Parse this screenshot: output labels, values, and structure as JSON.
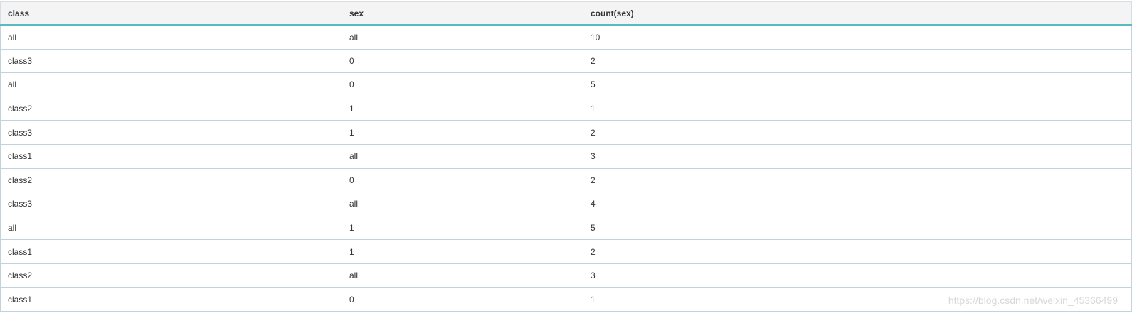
{
  "table": {
    "headers": [
      "class",
      "sex",
      "count(sex)"
    ],
    "rows": [
      [
        "all",
        "all",
        "10"
      ],
      [
        "class3",
        "0",
        "2"
      ],
      [
        "all",
        "0",
        "5"
      ],
      [
        "class2",
        "1",
        "1"
      ],
      [
        "class3",
        "1",
        "2"
      ],
      [
        "class1",
        "all",
        "3"
      ],
      [
        "class2",
        "0",
        "2"
      ],
      [
        "class3",
        "all",
        "4"
      ],
      [
        "all",
        "1",
        "5"
      ],
      [
        "class1",
        "1",
        "2"
      ],
      [
        "class2",
        "all",
        "3"
      ],
      [
        "class1",
        "0",
        "1"
      ]
    ]
  },
  "watermark": "https://blog.csdn.net/weixin_45366499",
  "colors": {
    "header_bg": "#f4f4f4",
    "header_accent": "#5ab9c1",
    "row_border": "#c2d3dc",
    "text": "#333333"
  }
}
